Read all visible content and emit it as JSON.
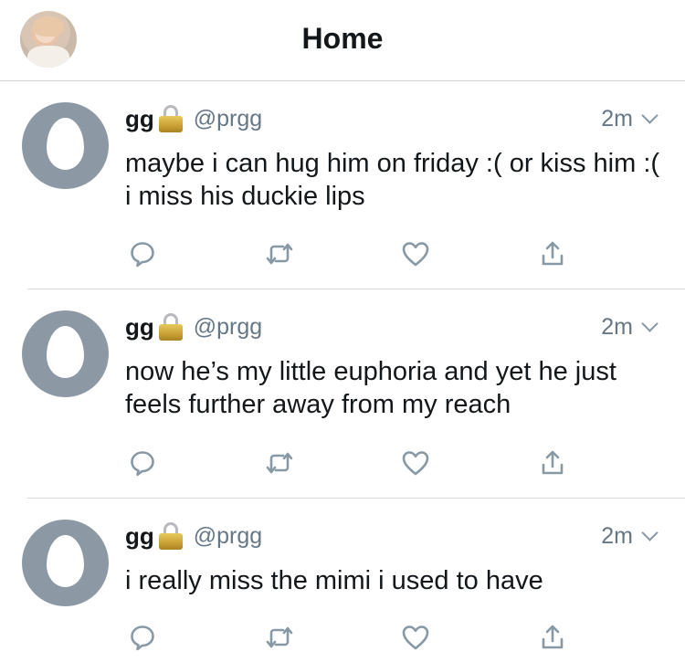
{
  "header": {
    "title": "Home",
    "avatar_icon": "profile-avatar"
  },
  "tweets": [
    {
      "name": "gg",
      "handle": "@prgg",
      "time": "2m",
      "text": "maybe i can hug him on friday :( or kiss him :( i miss his duckie lips"
    },
    {
      "name": "gg",
      "handle": "@prgg",
      "time": "2m",
      "text": "now he’s my little euphoria and yet he just feels further away from my reach"
    },
    {
      "name": "gg",
      "handle": "@prgg",
      "time": "2m",
      "text": "i really miss the mimi i used to have"
    }
  ],
  "icons": {
    "reply": "reply-icon",
    "retweet": "retweet-icon",
    "like": "heart-icon",
    "share": "share-icon",
    "lock": "lock-icon",
    "caret": "chevron-down-icon"
  },
  "colors": {
    "text": "#14171a",
    "secondary": "#657786",
    "icon": "#8899a6",
    "egg_avatar": "#8c99a5",
    "divider": "#d6dadd"
  }
}
